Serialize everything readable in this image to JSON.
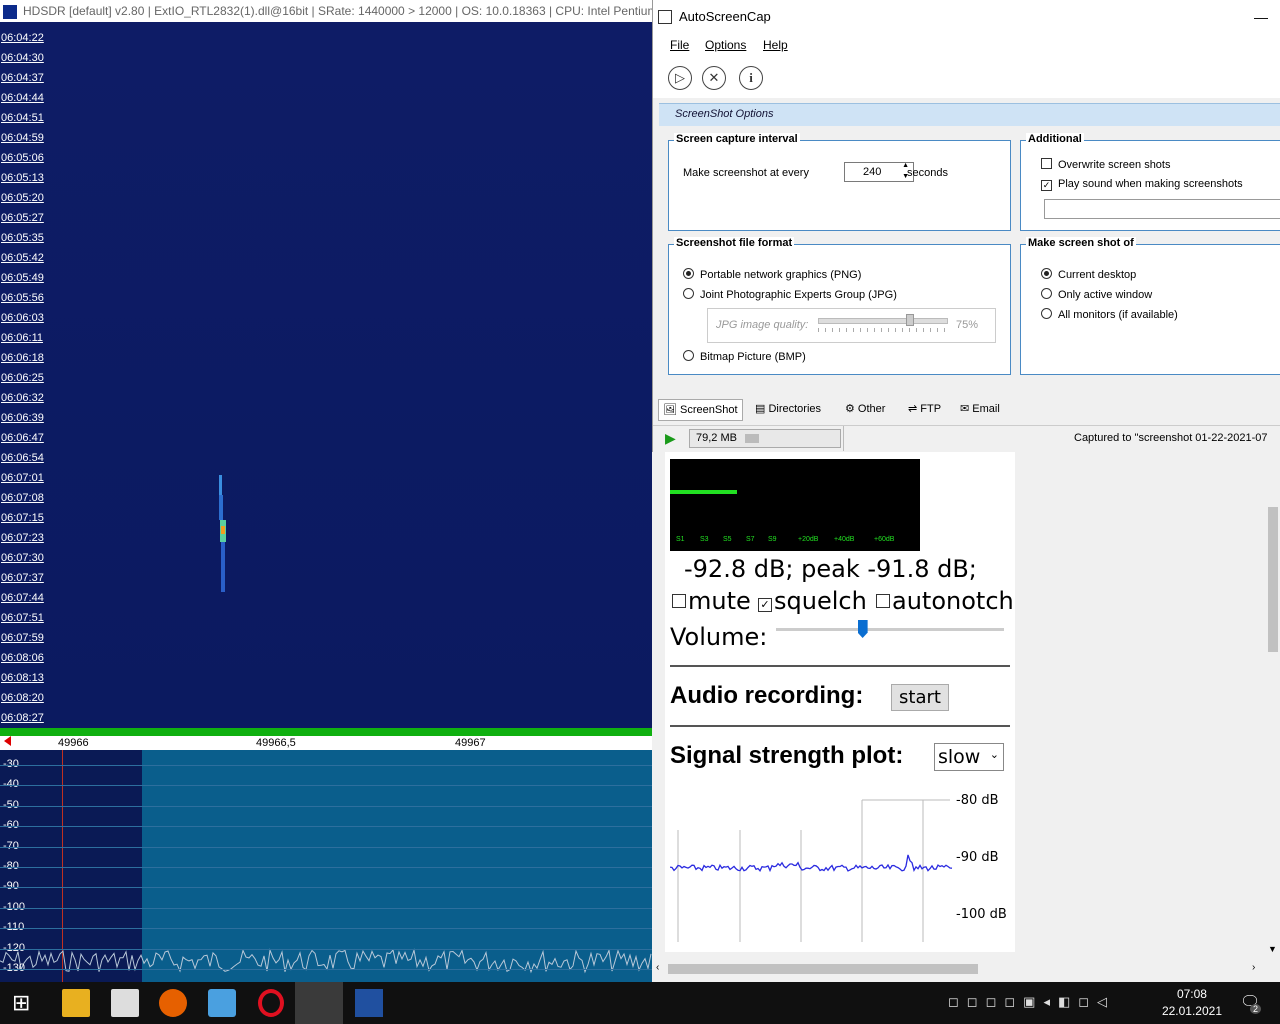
{
  "hdsdr": {
    "title": "HDSDR  [default]  v2.80   | ExtIO_RTL2832(1).dll@16bit   | SRate: 1440000 > 12000   | OS: 10.0.18363   | CPU: Intel Pentium",
    "times": [
      "06:04:22",
      "06:04:30",
      "06:04:37",
      "06:04:44",
      "06:04:51",
      "06:04:59",
      "06:05:06",
      "06:05:13",
      "06:05:20",
      "06:05:27",
      "06:05:35",
      "06:05:42",
      "06:05:49",
      "06:05:56",
      "06:06:03",
      "06:06:11",
      "06:06:18",
      "06:06:25",
      "06:06:32",
      "06:06:39",
      "06:06:47",
      "06:06:54",
      "06:07:01",
      "06:07:08",
      "06:07:15",
      "06:07:23",
      "06:07:30",
      "06:07:37",
      "06:07:44",
      "06:07:51",
      "06:07:59",
      "06:08:06",
      "06:08:13",
      "06:08:20",
      "06:08:27"
    ],
    "freq_labels": [
      "49966",
      "49966,5",
      "49967"
    ],
    "db_labels": [
      "-30",
      "-40",
      "-50",
      "-60",
      "-70",
      "-80",
      "-90",
      "-100",
      "-110",
      "-120",
      "-130"
    ]
  },
  "asc": {
    "title": "AutoScreenCap",
    "menu": {
      "file": "File",
      "options": "Options",
      "help": "Help"
    },
    "header": "ScreenShot Options",
    "capture": {
      "label": "Screen capture interval",
      "prefix": "Make screenshot at every",
      "value": "240",
      "suffix": "seconds"
    },
    "additional": {
      "label": "Additional",
      "overwrite": "Overwrite screen shots",
      "sound": "Play sound when making screenshots"
    },
    "format": {
      "label": "Screenshot file format",
      "png": "Portable network graphics (PNG)",
      "jpg": "Joint Photographic Experts Group (JPG)",
      "jpg_quality_label": "JPG image quality:",
      "jpg_quality_value": "75%",
      "bmp": "Bitmap Picture (BMP)"
    },
    "target": {
      "label": "Make screen shot of",
      "desktop": "Current desktop",
      "active": "Only active window",
      "all": "All monitors (if available)"
    },
    "tabs": {
      "screenshot": "ScreenShot",
      "directories": "Directories",
      "other": "Other",
      "ftp": "FTP",
      "email": "Email"
    },
    "status": {
      "size": "79,2 MB",
      "captured": "Captured to \"screenshot 01-22-2021-07"
    }
  },
  "receiver": {
    "smeter_labels": [
      "S1",
      "S3",
      "S5",
      "S7",
      "S9",
      "+20dB",
      "+40dB",
      "+60dB"
    ],
    "level_text": "-92.8 dB; peak   -91.8 dB;",
    "mute": "mute",
    "squelch": "squelch",
    "autonotch": "autonotch",
    "volume_label": "Volume:",
    "volume_level": 0.38,
    "audio_label": "Audio recording:",
    "start_button": "start",
    "signal_label": "Signal strength plot:",
    "speed_value": "slow",
    "plot_labels": [
      "-80 dB",
      "-90 dB",
      "-100 dB"
    ]
  },
  "taskbar": {
    "time": "07:08",
    "date": "22.01.2021",
    "notifications": "2"
  }
}
